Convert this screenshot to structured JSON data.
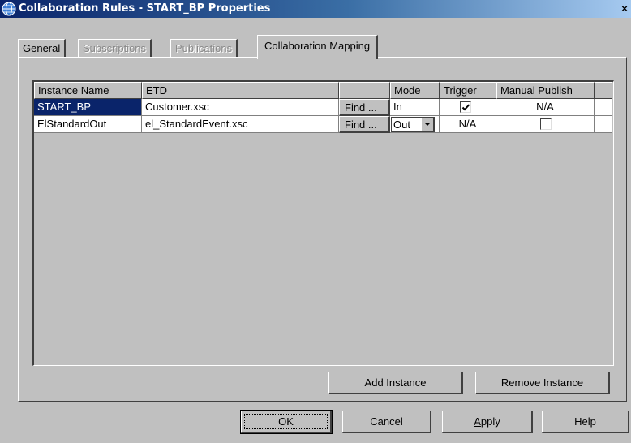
{
  "window": {
    "title": "Collaboration Rules - START_BP Properties",
    "close_label": "×"
  },
  "tabs": [
    {
      "label": "General",
      "state": "normal"
    },
    {
      "label": "Subscriptions",
      "state": "disabled"
    },
    {
      "label": "Publications",
      "state": "disabled"
    },
    {
      "label": "Collaboration Mapping",
      "state": "active"
    }
  ],
  "table": {
    "columns": [
      "Instance Name",
      "ETD",
      "",
      "Mode",
      "Trigger",
      "Manual Publish",
      ""
    ],
    "rows": [
      {
        "instance_name": "START_BP",
        "etd": "Customer.xsc",
        "find_label": "Find ...",
        "mode": "In",
        "trigger_checked": true,
        "manual_publish": "N/A",
        "selected": true
      },
      {
        "instance_name": "ElStandardOut",
        "etd": "el_StandardEvent.xsc",
        "find_label": "Find ...",
        "mode": "Out",
        "trigger": "N/A",
        "manual_publish_checked": false,
        "selected": false
      }
    ]
  },
  "panel_buttons": {
    "add_instance": "Add Instance",
    "remove_instance": "Remove Instance"
  },
  "dialog_buttons": {
    "ok": "OK",
    "cancel": "Cancel",
    "apply_underlined": "A",
    "apply_rest": "pply",
    "help": "Help"
  },
  "colors": {
    "selection": "#0a246a",
    "face": "#c0c0c0"
  }
}
